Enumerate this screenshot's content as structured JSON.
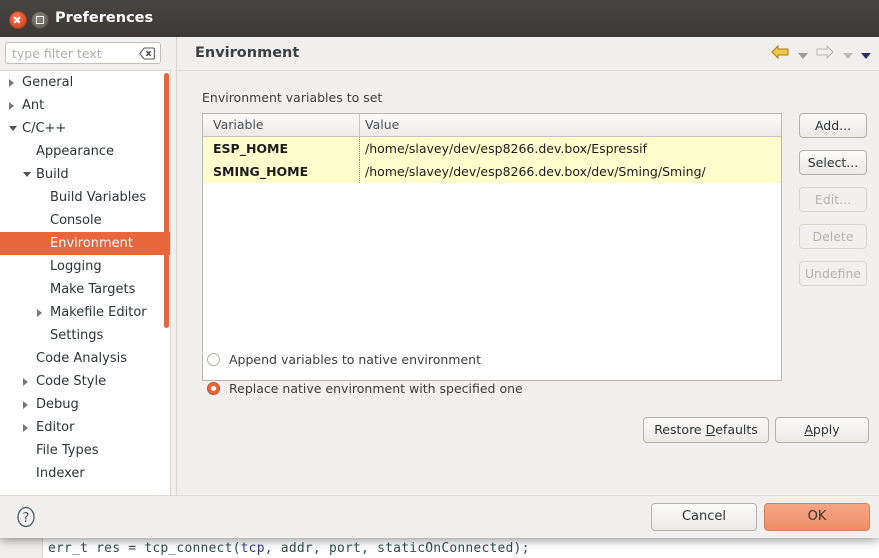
{
  "window": {
    "title": "Preferences",
    "close_icon": "close-icon",
    "maximize_icon": "maximize-icon"
  },
  "filter": {
    "placeholder": "type filter text",
    "value": "",
    "clear_icon": "clear-icon"
  },
  "sidebar": {
    "items": [
      {
        "label": "General",
        "indent": 1,
        "twisty": "collapsed",
        "selected": false
      },
      {
        "label": "Ant",
        "indent": 1,
        "twisty": "collapsed",
        "selected": false
      },
      {
        "label": "C/C++",
        "indent": 1,
        "twisty": "expanded",
        "selected": false
      },
      {
        "label": "Appearance",
        "indent": 2,
        "twisty": "none",
        "selected": false
      },
      {
        "label": "Build",
        "indent": 2,
        "twisty": "expanded",
        "selected": false
      },
      {
        "label": "Build Variables",
        "indent": 3,
        "twisty": "none",
        "selected": false
      },
      {
        "label": "Console",
        "indent": 3,
        "twisty": "none",
        "selected": false
      },
      {
        "label": "Environment",
        "indent": 3,
        "twisty": "none",
        "selected": true
      },
      {
        "label": "Logging",
        "indent": 3,
        "twisty": "none",
        "selected": false
      },
      {
        "label": "Make Targets",
        "indent": 3,
        "twisty": "none",
        "selected": false
      },
      {
        "label": "Makefile Editor",
        "indent": 3,
        "twisty": "collapsed",
        "selected": false
      },
      {
        "label": "Settings",
        "indent": 3,
        "twisty": "none",
        "selected": false
      },
      {
        "label": "Code Analysis",
        "indent": 2,
        "twisty": "none",
        "selected": false
      },
      {
        "label": "Code Style",
        "indent": 2,
        "twisty": "collapsed",
        "selected": false
      },
      {
        "label": "Debug",
        "indent": 2,
        "twisty": "collapsed",
        "selected": false
      },
      {
        "label": "Editor",
        "indent": 2,
        "twisty": "collapsed",
        "selected": false
      },
      {
        "label": "File Types",
        "indent": 2,
        "twisty": "none",
        "selected": false
      },
      {
        "label": "Indexer",
        "indent": 2,
        "twisty": "none",
        "selected": false
      }
    ]
  },
  "content": {
    "page_title": "Environment",
    "section_label": "Environment variables to set",
    "nav": {
      "back_icon": "back-arrow-icon",
      "back_menu_icon": "chevron-down-icon",
      "forward_icon": "forward-arrow-icon",
      "forward_menu_icon": "chevron-down-icon",
      "view_menu_icon": "chevron-down-icon"
    },
    "table": {
      "columns": [
        "Variable",
        "Value"
      ],
      "rows": [
        {
          "variable": "ESP_HOME",
          "value": "/home/slavey/dev/esp8266.dev.box/Espressif"
        },
        {
          "variable": "SMING_HOME",
          "value": "/home/slavey/dev/esp8266.dev.box/dev/Sming/Sming/"
        }
      ]
    },
    "side_buttons": [
      {
        "label": "Add...",
        "enabled": true
      },
      {
        "label": "Select...",
        "enabled": true
      },
      {
        "label": "Edit...",
        "enabled": false
      },
      {
        "label": "Delete",
        "enabled": false
      },
      {
        "label": "Undefine",
        "enabled": false
      }
    ],
    "radios": [
      {
        "label": "Append variables to native environment",
        "checked": false
      },
      {
        "label": "Replace native environment with specified one",
        "checked": true
      }
    ],
    "restore_defaults": {
      "pre": "Restore ",
      "mnemonic": "D",
      "post": "efaults"
    },
    "apply": {
      "pre": "",
      "mnemonic": "A",
      "post": "pply"
    }
  },
  "footer": {
    "help_icon": "help-icon",
    "cancel_label": "Cancel",
    "ok_label": "OK"
  },
  "backdrop": {
    "code_pre": "err_t res = tcp_connect(",
    "code_kw": "tcp",
    "code_post": ", addr, port, staticOnConnected);"
  },
  "colors": {
    "accent": "#e8663c",
    "ok_button": "#ef8f68",
    "row_highlight": "#ffffcd",
    "titlebar": "#3c3936"
  }
}
